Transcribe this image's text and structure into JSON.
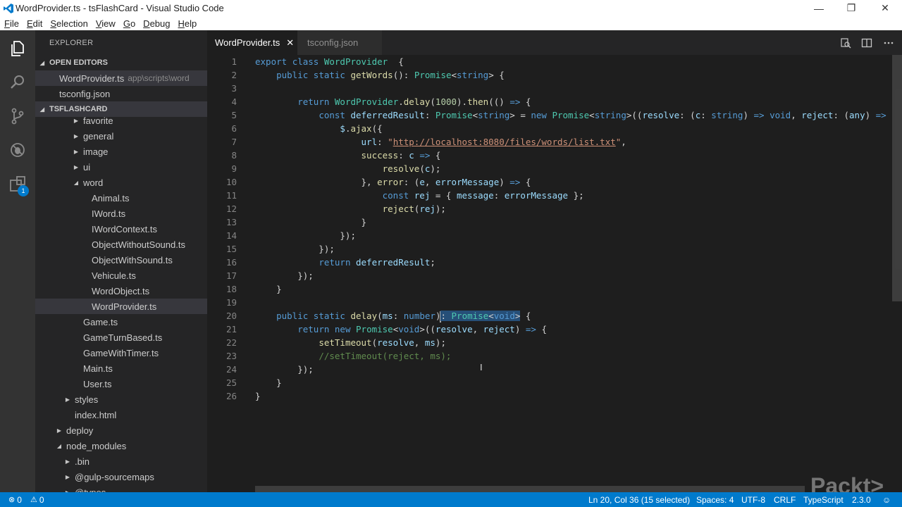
{
  "window": {
    "title": "WordProvider.ts - tsFlashCard - Visual Studio Code",
    "controls": {
      "minimize": "—",
      "maximize": "❐",
      "close": "✕"
    }
  },
  "menu": [
    "File",
    "Edit",
    "Selection",
    "View",
    "Go",
    "Debug",
    "Help"
  ],
  "activity_bar": {
    "icons": [
      "files-icon",
      "search-icon",
      "source-control-icon",
      "debug-icon",
      "extensions-icon"
    ],
    "extensions_badge": "1"
  },
  "sidebar": {
    "title": "EXPLORER",
    "open_editors": {
      "header": "OPEN EDITORS",
      "items": [
        {
          "name": "WordProvider.ts",
          "path": "app\\scripts\\word"
        },
        {
          "name": "tsconfig.json",
          "path": ""
        }
      ]
    },
    "project": {
      "header": "TSFLASHCARD",
      "tree": [
        {
          "label": "favorite",
          "indent": 3,
          "twisty": "▶"
        },
        {
          "label": "general",
          "indent": 3,
          "twisty": "▶"
        },
        {
          "label": "image",
          "indent": 3,
          "twisty": "▶"
        },
        {
          "label": "ui",
          "indent": 3,
          "twisty": "▶"
        },
        {
          "label": "word",
          "indent": 3,
          "twisty": "◢"
        },
        {
          "label": "Animal.ts",
          "indent": 4,
          "twisty": ""
        },
        {
          "label": "IWord.ts",
          "indent": 4,
          "twisty": ""
        },
        {
          "label": "IWordContext.ts",
          "indent": 4,
          "twisty": ""
        },
        {
          "label": "ObjectWithoutSound.ts",
          "indent": 4,
          "twisty": ""
        },
        {
          "label": "ObjectWithSound.ts",
          "indent": 4,
          "twisty": ""
        },
        {
          "label": "Vehicule.ts",
          "indent": 4,
          "twisty": ""
        },
        {
          "label": "WordObject.ts",
          "indent": 4,
          "twisty": ""
        },
        {
          "label": "WordProvider.ts",
          "indent": 4,
          "twisty": "",
          "selected": true
        },
        {
          "label": "Game.ts",
          "indent": 3,
          "twisty": ""
        },
        {
          "label": "GameTurnBased.ts",
          "indent": 3,
          "twisty": ""
        },
        {
          "label": "GameWithTimer.ts",
          "indent": 3,
          "twisty": ""
        },
        {
          "label": "Main.ts",
          "indent": 3,
          "twisty": ""
        },
        {
          "label": "User.ts",
          "indent": 3,
          "twisty": ""
        },
        {
          "label": "styles",
          "indent": 2,
          "twisty": "▶"
        },
        {
          "label": "index.html",
          "indent": 2,
          "twisty": ""
        },
        {
          "label": "deploy",
          "indent": 1,
          "twisty": "▶"
        },
        {
          "label": "node_modules",
          "indent": 1,
          "twisty": "◢"
        },
        {
          "label": ".bin",
          "indent": 2,
          "twisty": "▶"
        },
        {
          "label": "@gulp-sourcemaps",
          "indent": 2,
          "twisty": "▶"
        },
        {
          "label": "@types",
          "indent": 2,
          "twisty": "▶"
        }
      ]
    }
  },
  "tabs": [
    {
      "label": "WordProvider.ts",
      "active": true,
      "close": "✕"
    },
    {
      "label": "tsconfig.json",
      "active": false
    }
  ],
  "tab_actions": [
    "open-changes-icon",
    "split-editor-icon",
    "more-icon"
  ],
  "editor": {
    "lines": [
      [
        [
          "k",
          "export "
        ],
        [
          "k",
          "class "
        ],
        [
          "t",
          "WordProvider"
        ],
        [
          "",
          "  {"
        ]
      ],
      [
        [
          "",
          "    "
        ],
        [
          "k",
          "public "
        ],
        [
          "k",
          "static "
        ],
        [
          "f",
          "getWords"
        ],
        [
          "",
          "(): "
        ],
        [
          "t",
          "Promise"
        ],
        [
          "",
          "<"
        ],
        [
          "k",
          "string"
        ],
        [
          "",
          "> {"
        ]
      ],
      [
        [
          "",
          ""
        ]
      ],
      [
        [
          "",
          "        "
        ],
        [
          "k",
          "return "
        ],
        [
          "t",
          "WordProvider"
        ],
        [
          "",
          "."
        ],
        [
          "f",
          "delay"
        ],
        [
          "",
          "("
        ],
        [
          "n",
          "1000"
        ],
        [
          "",
          ")."
        ],
        [
          "f",
          "then"
        ],
        [
          "",
          "(() "
        ],
        [
          "k",
          "=>"
        ],
        [
          "",
          " {"
        ]
      ],
      [
        [
          "",
          "            "
        ],
        [
          "k",
          "const "
        ],
        [
          "v",
          "deferredResult"
        ],
        [
          "",
          ": "
        ],
        [
          "t",
          "Promise"
        ],
        [
          "",
          "<"
        ],
        [
          "k",
          "string"
        ],
        [
          "",
          "> = "
        ],
        [
          "k",
          "new "
        ],
        [
          "t",
          "Promise"
        ],
        [
          "",
          "<"
        ],
        [
          "k",
          "string"
        ],
        [
          "",
          ">(("
        ],
        [
          "v",
          "resolve"
        ],
        [
          "",
          ": ("
        ],
        [
          "v",
          "c"
        ],
        [
          "",
          ": "
        ],
        [
          "k",
          "string"
        ],
        [
          "",
          ") "
        ],
        [
          "k",
          "=>"
        ],
        [
          "",
          " "
        ],
        [
          "k",
          "void"
        ],
        [
          "",
          ", "
        ],
        [
          "v",
          "reject"
        ],
        [
          "",
          ": ("
        ],
        [
          "v",
          "any"
        ],
        [
          "",
          ") "
        ],
        [
          "k",
          "=>"
        ]
      ],
      [
        [
          "",
          "                "
        ],
        [
          "v",
          "$"
        ],
        [
          "",
          "."
        ],
        [
          "f",
          "ajax"
        ],
        [
          "",
          "({"
        ]
      ],
      [
        [
          "",
          "                    "
        ],
        [
          "v",
          "url"
        ],
        [
          "",
          ": "
        ],
        [
          "s",
          "\""
        ],
        [
          "u",
          "http://localhost:8080/files/words/list.txt"
        ],
        [
          "s",
          "\""
        ],
        [
          "",
          ","
        ]
      ],
      [
        [
          "",
          "                    "
        ],
        [
          "f",
          "success"
        ],
        [
          "",
          ": "
        ],
        [
          "v",
          "c"
        ],
        [
          "",
          " "
        ],
        [
          "k",
          "=>"
        ],
        [
          "",
          " {"
        ]
      ],
      [
        [
          "",
          "                        "
        ],
        [
          "f",
          "resolve"
        ],
        [
          "",
          "("
        ],
        [
          "v",
          "c"
        ],
        [
          "",
          ");"
        ]
      ],
      [
        [
          "",
          "                    }, "
        ],
        [
          "f",
          "error"
        ],
        [
          "",
          ": ("
        ],
        [
          "v",
          "e"
        ],
        [
          "",
          ", "
        ],
        [
          "v",
          "errorMessage"
        ],
        [
          "",
          ") "
        ],
        [
          "k",
          "=>"
        ],
        [
          "",
          " {"
        ]
      ],
      [
        [
          "",
          "                        "
        ],
        [
          "k",
          "const "
        ],
        [
          "v",
          "rej"
        ],
        [
          "",
          " = { "
        ],
        [
          "v",
          "message"
        ],
        [
          "",
          ": "
        ],
        [
          "v",
          "errorMessage"
        ],
        [
          "",
          " };"
        ]
      ],
      [
        [
          "",
          "                        "
        ],
        [
          "f",
          "reject"
        ],
        [
          "",
          "("
        ],
        [
          "v",
          "rej"
        ],
        [
          "",
          ");"
        ]
      ],
      [
        [
          "",
          "                    }"
        ]
      ],
      [
        [
          "",
          "                });"
        ]
      ],
      [
        [
          "",
          "            });"
        ]
      ],
      [
        [
          "",
          "            "
        ],
        [
          "k",
          "return "
        ],
        [
          "v",
          "deferredResult"
        ],
        [
          "",
          ";"
        ]
      ],
      [
        [
          "",
          "        });"
        ]
      ],
      [
        [
          "",
          "    }"
        ]
      ],
      [
        [
          "",
          ""
        ]
      ],
      [
        [
          "",
          "    "
        ],
        [
          "k",
          "public "
        ],
        [
          "k",
          "static "
        ],
        [
          "f",
          "delay"
        ],
        [
          "",
          "("
        ],
        [
          "v",
          "ms"
        ],
        [
          "",
          ": "
        ],
        [
          "k",
          "number"
        ],
        [
          "",
          ")"
        ],
        [
          "cursor",
          ""
        ],
        [
          "sel",
          ": "
        ],
        [
          "sel-t",
          "Promise"
        ],
        [
          "sel",
          "<"
        ],
        [
          "sel-k",
          "void"
        ],
        [
          "sel",
          ">"
        ],
        [
          "",
          " {"
        ]
      ],
      [
        [
          "",
          "        "
        ],
        [
          "k",
          "return "
        ],
        [
          "k",
          "new "
        ],
        [
          "t",
          "Promise"
        ],
        [
          "",
          "<"
        ],
        [
          "k",
          "void"
        ],
        [
          "",
          ">(("
        ],
        [
          "v",
          "resolve"
        ],
        [
          "",
          ", "
        ],
        [
          "v",
          "reject"
        ],
        [
          "",
          ") "
        ],
        [
          "k",
          "=>"
        ],
        [
          "",
          " {"
        ]
      ],
      [
        [
          "",
          "            "
        ],
        [
          "f",
          "setTimeout"
        ],
        [
          "",
          "("
        ],
        [
          "v",
          "resolve"
        ],
        [
          "",
          ", "
        ],
        [
          "v",
          "ms"
        ],
        [
          "",
          ");"
        ]
      ],
      [
        [
          "",
          "            "
        ],
        [
          "c",
          "//setTimeout(reject, ms);"
        ]
      ],
      [
        [
          "",
          "        });"
        ]
      ],
      [
        [
          "",
          "    }"
        ]
      ],
      [
        [
          "",
          "}"
        ]
      ]
    ]
  },
  "status": {
    "errors": "0",
    "warnings": "0",
    "position": "Ln 20, Col 36 (15 selected)",
    "indent": "Spaces: 4",
    "encoding": "UTF-8",
    "eol": "CRLF",
    "language": "TypeScript",
    "version": "2.3.0",
    "feedback": "☺"
  },
  "watermark": "Packt>",
  "colors": {
    "accent": "#007acc",
    "activity_bar": "#333333",
    "sidebar": "#252526",
    "editor": "#1e1e1e"
  }
}
